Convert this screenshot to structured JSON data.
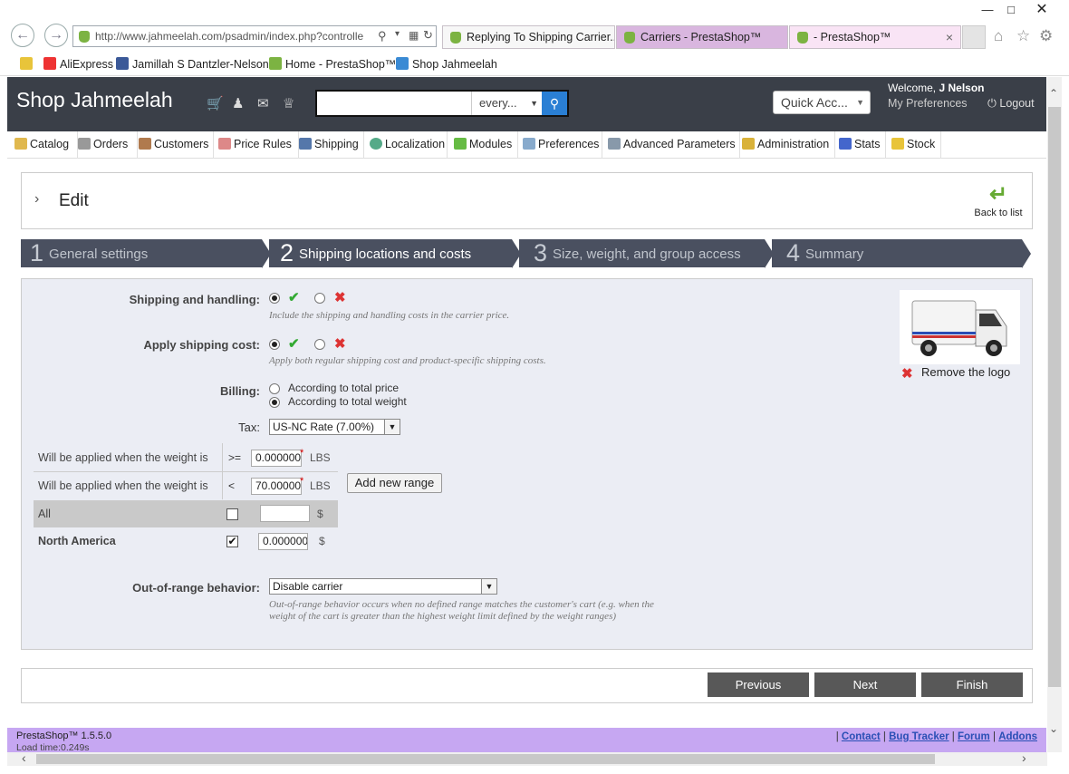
{
  "browser": {
    "url": "http://www.jahmeelah.com/psadmin/index.php?controlle",
    "tabs": [
      {
        "label": "Replying To Shipping Carrier..."
      },
      {
        "label": "Carriers - PrestaShop™"
      },
      {
        "label": "- PrestaShop™"
      }
    ],
    "favorites": [
      "AliExpress",
      "Jamillah S Dantzler-Nelson",
      "Home - PrestaShop™",
      "Shop Jahmeelah"
    ],
    "close_tab": "×"
  },
  "header": {
    "shop_name": "Shop Jahmeelah",
    "search_scope": "every...",
    "quick_access": "Quick Acc...",
    "welcome_prefix": "Welcome,",
    "welcome_user": "J Nelson",
    "my_preferences": "My Preferences",
    "logout": "Logout"
  },
  "menu": [
    "Catalog",
    "Orders",
    "Customers",
    "Price Rules",
    "Shipping",
    "Localization",
    "Modules",
    "Preferences",
    "Advanced Parameters",
    "Administration",
    "Stats",
    "Stock"
  ],
  "page": {
    "title": "Edit",
    "back_to_list": "Back to list"
  },
  "steps": [
    {
      "num": "1",
      "label": "General settings"
    },
    {
      "num": "2",
      "label": "Shipping locations and costs"
    },
    {
      "num": "3",
      "label": "Size, weight, and group access"
    },
    {
      "num": "4",
      "label": "Summary"
    }
  ],
  "form": {
    "shipping_handling_label": "Shipping and handling:",
    "shipping_handling_hint": "Include the shipping and handling costs in the carrier price.",
    "apply_cost_label": "Apply shipping cost:",
    "apply_cost_hint": "Apply both regular shipping cost and product-specific shipping costs.",
    "billing_label": "Billing:",
    "billing_opt1": "According to total price",
    "billing_opt2": "According to total weight",
    "tax_label": "Tax:",
    "tax_value": "US-NC Rate (7.00%)",
    "range_row1_label": "Will be applied when the weight is",
    "range_row1_op": ">=",
    "range_row1_value": "0.000000",
    "range_row2_label": "Will be applied when the weight is",
    "range_row2_op": "<",
    "range_row2_value": "70.00000",
    "unit": "LBS",
    "add_range": "Add new range",
    "all_label": "All",
    "all_value": "",
    "currency": "$",
    "zone_label": "North America",
    "zone_value": "0.000000",
    "oor_label": "Out-of-range behavior:",
    "oor_value": "Disable carrier",
    "oor_hint_1": "Out-of-range behavior occurs when no defined range matches the customer's cart (e.g. when the",
    "oor_hint_2": "weight of the cart is greater than the highest weight limit defined by the weight ranges)",
    "remove_logo": "Remove the logo",
    "required_mark": "*"
  },
  "buttons": {
    "previous": "Previous",
    "next": "Next",
    "finish": "Finish"
  },
  "footer": {
    "version": "PrestaShop™ 1.5.5.0",
    "load_time": "Load time:0.249s",
    "links": [
      "Contact",
      "Bug Tracker",
      "Forum",
      "Addons"
    ],
    "separator": "|"
  },
  "colors": {
    "header": "#3a3f48",
    "step": "#4a5060",
    "footer": "#c6a7f2",
    "panel": "#ebedf4",
    "accent": "#2a7fd4"
  }
}
